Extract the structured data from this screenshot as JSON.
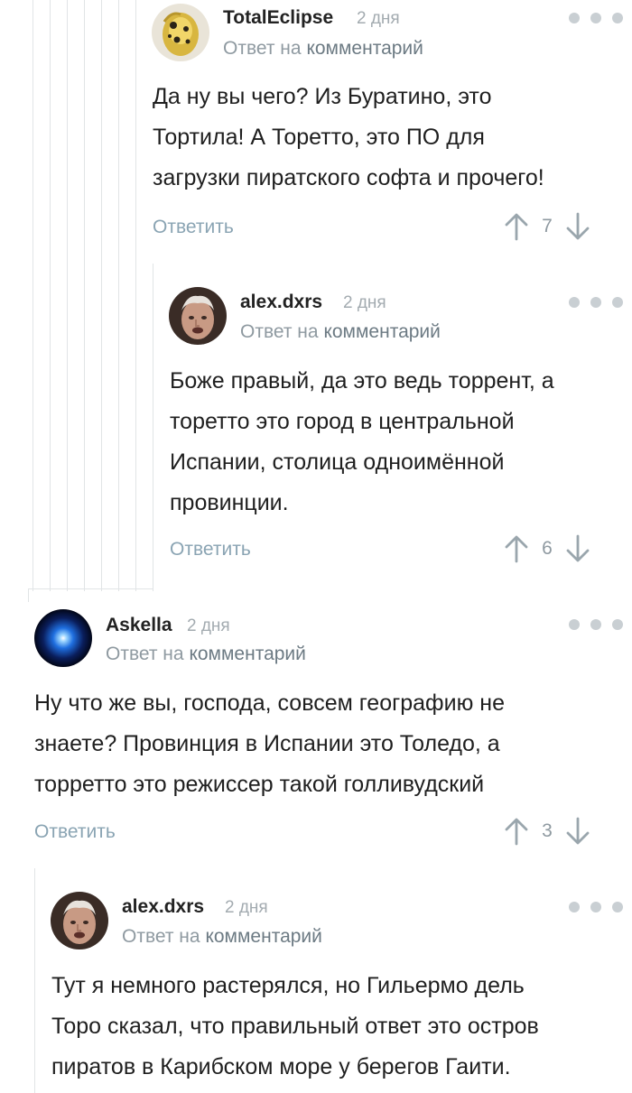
{
  "comments": [
    {
      "author": "TotalEclipse",
      "time": "2 дня",
      "reply_prefix": "Ответ на",
      "reply_link": "комментарий",
      "body": [
        "Да ну вы чего? Из Буратино, это",
        "Тортила! А Торетто, это ПО для",
        "загрузки пиратского софта и прочего!"
      ],
      "reply_label": "Ответить",
      "rating": "7",
      "avatar": "golden-ornament-avatar"
    },
    {
      "author": "alex.dxrs",
      "time": "2 дня",
      "reply_prefix": "Ответ на",
      "reply_link": "комментарий",
      "body": [
        "Боже правый, да это ведь торрент, а",
        "торетто это город в центральной",
        "Испании, столица одноимённой",
        "провинции."
      ],
      "reply_label": "Ответить",
      "rating": "6",
      "avatar": "man-face-avatar"
    },
    {
      "author": "Askella",
      "time": "2 дня",
      "reply_prefix": "Ответ на",
      "reply_link": "комментарий",
      "body": [
        "Ну что же вы, господа, совсем географию не",
        "знаете? Провинция в Испании это Толедо, а",
        "торретто это режиссер такой голливудский"
      ],
      "reply_label": "Ответить",
      "rating": "3",
      "avatar": "blue-glow-avatar"
    },
    {
      "author": "alex.dxrs",
      "time": "2 дня",
      "reply_prefix": "Ответ на",
      "reply_link": "комментарий",
      "body": [
        "Тут я немного растерялся, но Гильермо дель",
        "Торо сказал, что правильный ответ это остров",
        "пиратов в Карибском море у берегов Гаити."
      ],
      "avatar": "man-face-avatar"
    }
  ],
  "colors": {
    "thread_line": "#e1e4e6",
    "reply_button": "#8aa4b3",
    "muted": "#8f9aa1",
    "arrow": "#9aa6ad"
  },
  "icons": {
    "upvote": "arrow-up-icon",
    "downvote": "arrow-down-icon",
    "menu": "more-dots-icon"
  }
}
